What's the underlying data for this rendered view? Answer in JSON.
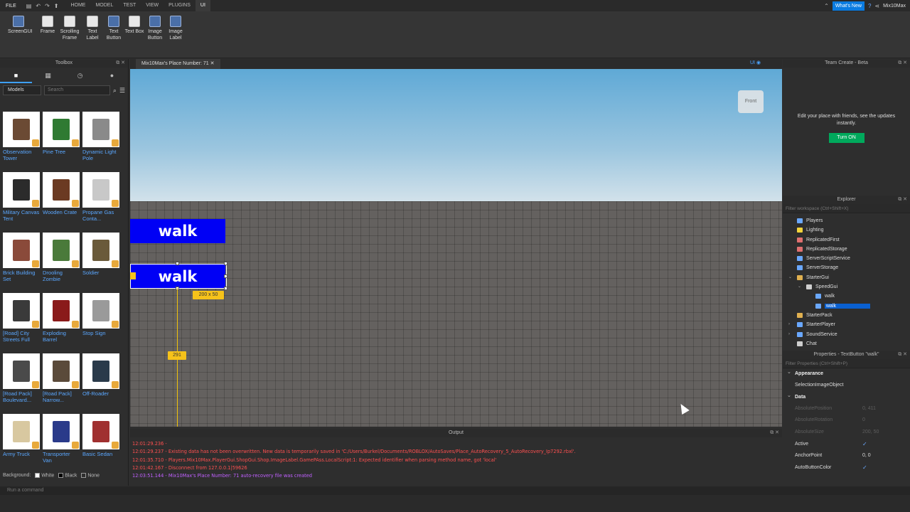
{
  "menubar": {
    "file": "FILE",
    "tabs": [
      "HOME",
      "MODEL",
      "TEST",
      "VIEW",
      "PLUGINS",
      "UI"
    ],
    "active_tab": "UI",
    "whats_new": "What's New",
    "user": "Mix10Max"
  },
  "ribbon": {
    "items": [
      {
        "label": "ScreenGUI"
      },
      {
        "label": "Frame"
      },
      {
        "label": "Scrolling Frame"
      },
      {
        "label": "Text Label"
      },
      {
        "label": "Text Button"
      },
      {
        "label": "Text Box"
      },
      {
        "label": "Image Button"
      },
      {
        "label": "Image Label"
      }
    ]
  },
  "toolbox": {
    "title": "Toolbox",
    "category": "Models",
    "search_placeholder": "Search",
    "items": [
      {
        "label": "Observation Tower"
      },
      {
        "label": "Pine Tree"
      },
      {
        "label": "Dynamic Light Pole"
      },
      {
        "label": "Military Canvas Tent"
      },
      {
        "label": "Wooden Crate"
      },
      {
        "label": "Propane Gas Conta..."
      },
      {
        "label": "Brick Building Set"
      },
      {
        "label": "Drooling Zombie"
      },
      {
        "label": "Soldier"
      },
      {
        "label": "[Road] City Streets Full"
      },
      {
        "label": "Exploding Barrel"
      },
      {
        "label": "Stop Sign"
      },
      {
        "label": "[Road Pack] Boulevard..."
      },
      {
        "label": "[Road Pack] Narrow..."
      },
      {
        "label": "Off-Roader"
      },
      {
        "label": "Army Truck"
      },
      {
        "label": "Transporter Van"
      },
      {
        "label": "Basic Sedan"
      }
    ],
    "background_label": "Background:",
    "background_options": [
      "White",
      "Black",
      "None"
    ]
  },
  "viewport": {
    "tab_title": "Mix10Max's Place Number: 71",
    "ui_toggle": "UI",
    "view_cube_label": "Front",
    "buttons": [
      {
        "text": "walk"
      },
      {
        "text": "walk"
      }
    ],
    "size_tag": "200 x 50",
    "guide_tag": "291"
  },
  "output": {
    "title": "Output",
    "lines": [
      {
        "text": "12:01:29.236 -",
        "color": "red"
      },
      {
        "text": "12:01:29.237 - Existing data has not been overwritten. New data is temporarily saved in 'C:/Users/Burkel/Documents/ROBLOX/AutoSaves/Place_AutoRecovery_5_AutoRecovery_Ip7292.rbxl'.",
        "color": "red"
      },
      {
        "text": "12:01:35.710 - Players.Mix10Max.PlayerGui.ShopGui.Shop.ImageLabel.GamePAss.LocalScript:1: Expected identifier when parsing method name, got 'local'",
        "color": "red"
      },
      {
        "text": "12:01:42.167 - Disconnect from 127.0.0.1|59626",
        "color": "red"
      },
      {
        "text": "12:03:51.144 - Mix10Max's Place Number: 71 auto-recovery file was created",
        "color": "purple"
      }
    ]
  },
  "command_bar": {
    "placeholder": "Run a command"
  },
  "team_create": {
    "title": "Team Create - Beta",
    "message": "Edit your place with friends, see the updates instantly.",
    "button": "Turn ON"
  },
  "explorer": {
    "title": "Explorer",
    "filter_placeholder": "Filter workspace (Ctrl+Shift+X)",
    "items": [
      {
        "label": "Players",
        "indent": 0,
        "icon_color": "#6aa8ff"
      },
      {
        "label": "Lighting",
        "indent": 0,
        "icon_color": "#f3d33b"
      },
      {
        "label": "ReplicatedFirst",
        "indent": 0,
        "icon_color": "#e07070"
      },
      {
        "label": "ReplicatedStorage",
        "indent": 0,
        "icon_color": "#e07070"
      },
      {
        "label": "ServerScriptService",
        "indent": 0,
        "icon_color": "#6aa8ff"
      },
      {
        "label": "ServerStorage",
        "indent": 0,
        "icon_color": "#6aa8ff"
      },
      {
        "label": "StarterGui",
        "indent": 0,
        "icon_color": "#e0b050",
        "arrow": "⌄"
      },
      {
        "label": "SpeedGui",
        "indent": 1,
        "icon_color": "#cfcfcf",
        "arrow": "⌄"
      },
      {
        "label": "walk",
        "indent": 2,
        "icon_color": "#6aa8ff"
      },
      {
        "label": "walk",
        "indent": 2,
        "icon_color": "#6aa8ff",
        "selected": true
      },
      {
        "label": "StarterPack",
        "indent": 0,
        "icon_color": "#e0b050"
      },
      {
        "label": "StarterPlayer",
        "indent": 0,
        "icon_color": "#6aa8ff",
        "arrow": "›"
      },
      {
        "label": "SoundService",
        "indent": 0,
        "icon_color": "#6aa8ff",
        "arrow": "›"
      },
      {
        "label": "Chat",
        "indent": 0,
        "icon_color": "#cfcfcf"
      }
    ]
  },
  "properties": {
    "title": "Properties - TextButton \"walk\"",
    "filter_placeholder": "Filter Properties (Ctrl+Shift+P)",
    "sections": {
      "appearance": "Appearance",
      "data": "Data"
    },
    "appearance_rows": [
      {
        "name": "SelectionImageObject",
        "value": ""
      }
    ],
    "data_rows": [
      {
        "name": "AbsolutePosition",
        "value": "0, 411",
        "dim": true
      },
      {
        "name": "AbsoluteRotation",
        "value": "0",
        "dim": true
      },
      {
        "name": "AbsoluteSize",
        "value": "200, 50",
        "dim": true
      },
      {
        "name": "Active",
        "value": "✓",
        "check": true
      },
      {
        "name": "AnchorPoint",
        "value": "0, 0"
      },
      {
        "name": "AutoButtonColor",
        "value": "✓",
        "check": true
      }
    ]
  }
}
